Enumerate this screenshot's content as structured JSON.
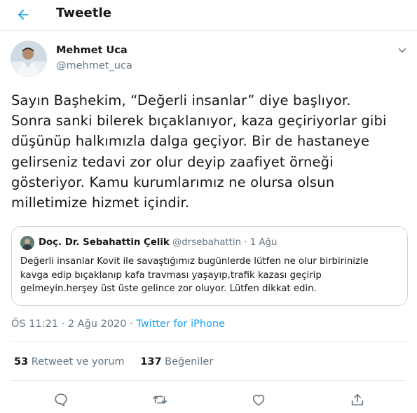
{
  "header": {
    "title": "Tweetle",
    "back_icon": "back-arrow-icon",
    "accent": "#1da1f2"
  },
  "author": {
    "name": "Mehmet Uca",
    "handle": "@mehmet_uca"
  },
  "tweet": {
    "lines": [
      "Sayın Başhekim, “Değerli insanlar” diye başlıyor.",
      "Sonra sanki bilerek bıçaklanıyor, kaza geçiriyorlar gibi",
      "düşünüp halkımızla dalga geçiyor. Bir de hastaneye",
      "gelirseniz tedavi zor olur deyip zaafiyet örneği",
      "gösteriyor. Kamu kurumlarımız ne olursa olsun",
      "milletimize hizmet içindir."
    ]
  },
  "quote": {
    "name": "Doç. Dr. Sebahattin Çelik",
    "handle": "@drsebahattin",
    "separator": "·",
    "date": "1 Ağu",
    "lines": [
      "Değerli insanlar Kovit ile savaştığımız bugünlerde lütfen ne olur birbirinizle",
      "kavga edip bıçaklanıp kafa travması yaşayıp,trafik kazası geçirip",
      "gelmeyin.herşey üst üste gelince zor oluyor. Lütfen dikkat edin."
    ]
  },
  "meta": {
    "time": "ÖS 11:21",
    "separator1": "·",
    "date": "2 Ağu 2020",
    "separator2": "·",
    "source": "Twitter for iPhone"
  },
  "stats": {
    "retweets_count": "53",
    "retweets_label": "Retweet ve yorum",
    "likes_count": "137",
    "likes_label": "Beğeniler"
  },
  "actions": [
    "reply-icon",
    "retweet-icon",
    "like-icon",
    "share-icon"
  ],
  "colors": {
    "text": "#14171a",
    "secondary": "#657786",
    "border": "#e6ecf0",
    "link": "#1da1f2"
  }
}
